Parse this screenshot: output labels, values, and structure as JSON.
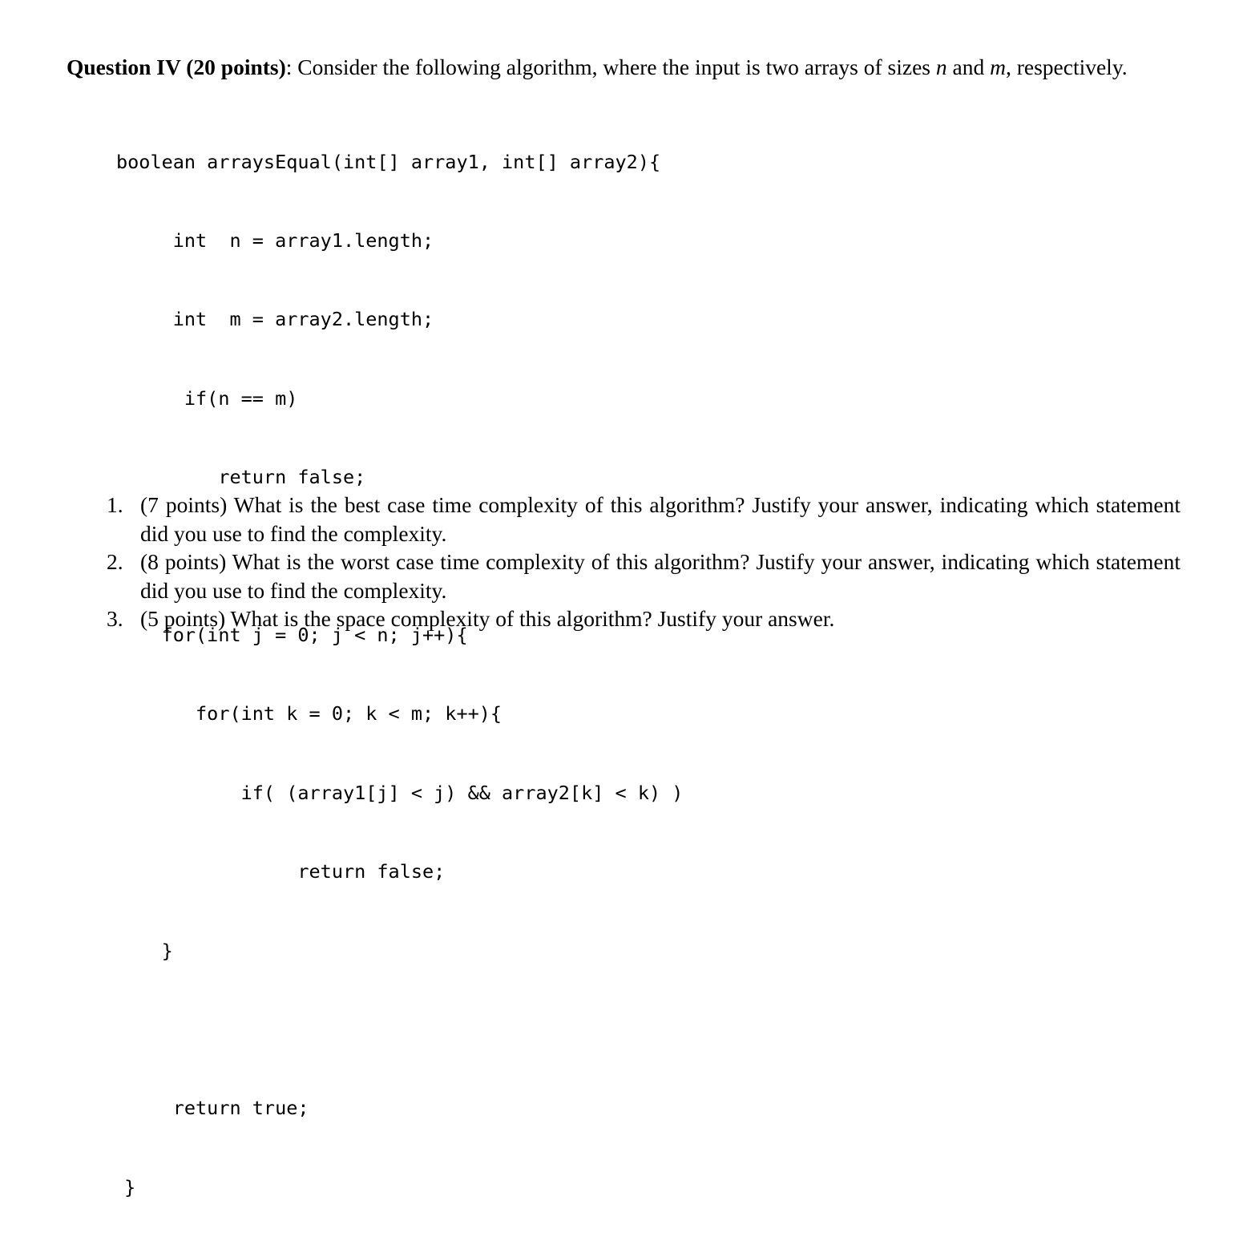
{
  "document": {
    "question_label": "Question IV (20 points)",
    "intro_part1": ": Consider the following algorithm, where the input is two arrays of sizes ",
    "intro_var_n": "n",
    "intro_between": " and ",
    "intro_var_m": "m",
    "intro_part2": ", respectively."
  },
  "code": {
    "language": "java",
    "lines": [
      "boolean arraysEqual(int[] array1, int[] array2){",
      "     int  n = array1.length;",
      "     int  m = array2.length;",
      "      if(n == m)",
      "         return false;",
      "",
      "    for(int j = 0; j < n; j++){",
      "       for(int k = 0; k < m; k++){",
      "           if( (array1[j] < j) && array2[k] < k) )",
      "                return false;",
      "    }",
      "",
      "     return true;",
      " }"
    ]
  },
  "questions": {
    "items": [
      {
        "marker": "1.",
        "text": "(7 points) What is the best case time complexity of this algorithm? Justify your answer, indicating which statement did you use to find the complexity."
      },
      {
        "marker": "2.",
        "text": "(8 points) What is the worst case time complexity of this algorithm? Justify your answer, indicating which statement did you use to find the complexity."
      },
      {
        "marker": "3.",
        "text": "(5 points) What is the space complexity of this algorithm? Justify your answer."
      }
    ]
  }
}
